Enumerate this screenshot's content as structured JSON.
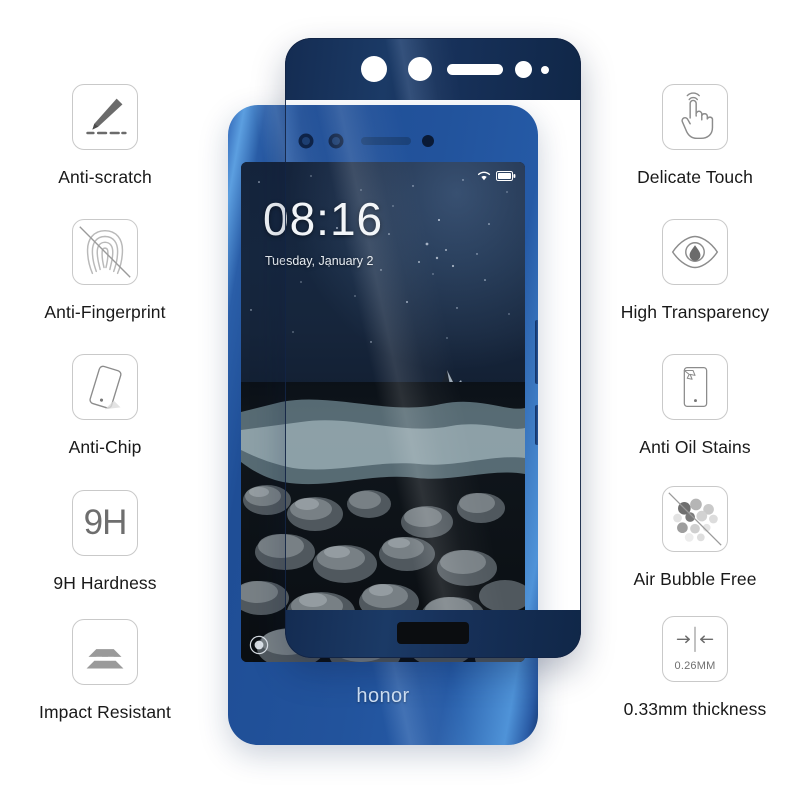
{
  "product": {
    "type": "tempered-glass-screen-protector",
    "brand": "honor",
    "thickness_label": "0.26MM",
    "hardness_label": "9H"
  },
  "colors": {
    "glass_band": "#17315a",
    "phone_blue": "#22539c",
    "icon_outline": "#c9c9c9",
    "icon_gray": "#6e6e6e",
    "text": "#191919",
    "background": "#ffffff"
  },
  "features_left": [
    {
      "id": "anti-scratch",
      "label": "Anti-scratch",
      "icon": "knife-scratch-icon"
    },
    {
      "id": "anti-fingerprint",
      "label": "Anti-Fingerprint",
      "icon": "fingerprint-crossed-icon"
    },
    {
      "id": "anti-chip",
      "label": "Anti-Chip",
      "icon": "phone-tilted-icon"
    },
    {
      "id": "9h-hardness",
      "label": "9H Hardness",
      "icon": "hardness-9h-icon"
    },
    {
      "id": "impact-resistant",
      "label": "Impact Resistant",
      "icon": "impact-layers-icon"
    }
  ],
  "features_right": [
    {
      "id": "delicate-touch",
      "label": "Delicate Touch",
      "icon": "hand-tap-icon"
    },
    {
      "id": "high-transparency",
      "label": "High Transparency",
      "icon": "eye-icon"
    },
    {
      "id": "anti-oil-stains",
      "label": "Anti Oil Stains",
      "icon": "phone-oil-stain-icon"
    },
    {
      "id": "air-bubble-free",
      "label": "Air Bubble Free",
      "icon": "bubbles-crossed-icon"
    },
    {
      "id": "thickness",
      "label": "0.33mm thickness",
      "icon": "thickness-arrows-icon"
    }
  ],
  "phone": {
    "brand_text": "honor",
    "lockscreen": {
      "time": "08:16",
      "date": "Tuesday, January 2",
      "wifi_icon": "wifi-icon",
      "battery_icon": "battery-icon",
      "left_shortcut_icon": "voice-assistant-icon",
      "right_shortcut_icon": "camera-icon"
    },
    "wallpaper_description": "night mountain river with rocks"
  }
}
